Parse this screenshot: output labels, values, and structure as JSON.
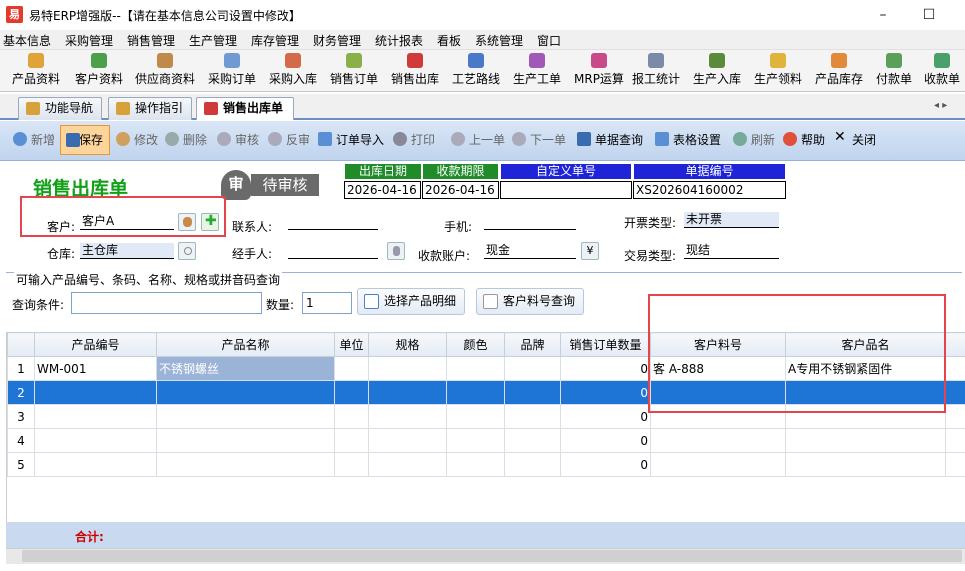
{
  "window": {
    "title": "易特ERP增强版--【请在基本信息公司设置中修改】",
    "app_icon": "易",
    "minimize": "–",
    "maximize": "☐"
  },
  "menu": [
    "基本信息",
    "采购管理",
    "销售管理",
    "生产管理",
    "库存管理",
    "财务管理",
    "统计报表",
    "看板",
    "系统管理",
    "窗口"
  ],
  "toolbar": [
    "产品资料",
    "客户资料",
    "供应商资料",
    "采购订单",
    "采购入库",
    "销售订单",
    "销售出库",
    "工艺路线",
    "生产工单",
    "MRP运算",
    "报工统计",
    "生产入库",
    "生产领料",
    "产品库存",
    "付款单",
    "收款单"
  ],
  "tabs": [
    "功能导航",
    "操作指引",
    "销售出库单"
  ],
  "tab_scroll": "◂ ▸",
  "form_toolbar": {
    "new": "新增",
    "save": "保存",
    "edit": "修改",
    "delete": "删除",
    "audit": "审核",
    "unaudit": "反审",
    "order_import": "订单导入",
    "print": "打印",
    "prev": "上一单",
    "next": "下一单",
    "query": "单据查询",
    "table_settings": "表格设置",
    "refresh": "刷新",
    "help": "帮助",
    "close": "关闭"
  },
  "form": {
    "title": "销售出库单",
    "stamp_char": "审",
    "stamp_text": "待审核",
    "header_labels": {
      "ship_date": "出库日期",
      "due_date": "收款期限",
      "custom_no": "自定义单号",
      "doc_no": "单据编号"
    },
    "header_values": {
      "ship_date": "2026-04-16",
      "due_date": "2026-04-16",
      "custom_no": "",
      "doc_no": "XS202604160002"
    },
    "customer_label": "客户:",
    "customer": "客户A",
    "contact_label": "联系人:",
    "contact": "",
    "phone_label": "手机:",
    "phone": "",
    "invoice_label": "开票类型:",
    "invoice": "未开票",
    "warehouse_label": "仓库:",
    "warehouse": "主仓库",
    "handler_label": "经手人:",
    "handler": "",
    "account_label": "收款账户:",
    "account": "现金",
    "account_btn": "¥",
    "trade_label": "交易类型:",
    "trade": "现结"
  },
  "search": {
    "group_title": "可输入产品编号、条码、名称、规格或拼音码查询",
    "cond_label": "查询条件:",
    "cond_value": "",
    "qty_label": "数量:",
    "qty": "1",
    "select_btn": "选择产品明细",
    "cust_part_btn": "客户料号查询"
  },
  "grid": {
    "columns": [
      "",
      "产品编号",
      "产品名称",
      "单位",
      "规格",
      "颜色",
      "品牌",
      "销售订单数量",
      "客户料号",
      "客户品名"
    ],
    "rows": [
      [
        "1",
        "WM-001",
        "不锈钢螺丝",
        "",
        "",
        "",
        "",
        "0",
        "客 A-888",
        "A专用不锈钢紧固件"
      ],
      [
        "2",
        "",
        "",
        "",
        "",
        "",
        "",
        "0",
        "",
        ""
      ],
      [
        "3",
        "",
        "",
        "",
        "",
        "",
        "",
        "0",
        "",
        ""
      ],
      [
        "4",
        "",
        "",
        "",
        "",
        "",
        "",
        "0",
        "",
        ""
      ],
      [
        "5",
        "",
        "",
        "",
        "",
        "",
        "",
        "0",
        "",
        ""
      ]
    ],
    "total_label": "合计:"
  },
  "colors": {
    "accent": "#12a018",
    "highlight_box": "#e3454a",
    "selection": "#1e75d6"
  }
}
